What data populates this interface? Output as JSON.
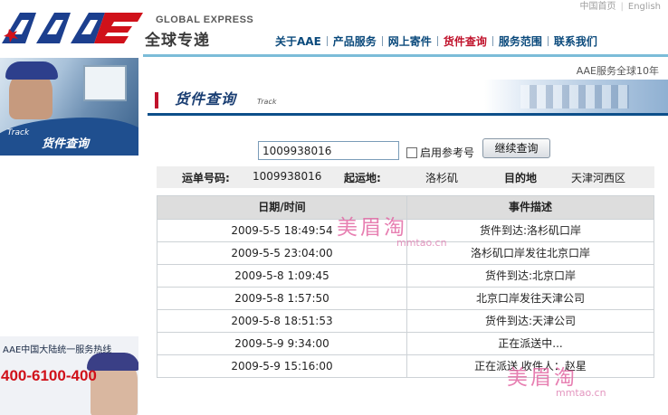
{
  "header": {
    "brand_en": "GLOBAL EXPRESS",
    "brand_cn": "全球专递",
    "logo_text": "AAE",
    "top_links": [
      "中国首页",
      "English"
    ],
    "nav": [
      {
        "label": "关于AAE",
        "active": false
      },
      {
        "label": "产品服务",
        "active": false
      },
      {
        "label": "网上寄件",
        "active": false
      },
      {
        "label": "货件查询",
        "active": true
      },
      {
        "label": "服务范围",
        "active": false
      },
      {
        "label": "联系我们",
        "active": false
      }
    ],
    "slogan": "AAE服务全球10年"
  },
  "left": {
    "banner_en": "Track",
    "banner_cn": "货件查询",
    "hotline_title": "AAE中国大陆统一服务热线",
    "hotline_number": "400-6100-400"
  },
  "page": {
    "title": "货件查询",
    "subtitle": "Track"
  },
  "search": {
    "value": "1009938016",
    "ref_label": "启用参考号",
    "button_label": "继续查询"
  },
  "info": {
    "waybill_label": "运单号码:",
    "waybill_value": "1009938016",
    "origin_label": "起运地:",
    "origin_value": "洛杉矶",
    "dest_label": "目的地",
    "dest_value": "天津河西区"
  },
  "events": {
    "headers": [
      "日期/时间",
      "事件描述"
    ],
    "rows": [
      {
        "time": "2009-5-5 18:49:54",
        "desc": "货件到达:洛杉矶口岸"
      },
      {
        "time": "2009-5-5 23:04:00",
        "desc": "洛杉矶口岸发往北京口岸"
      },
      {
        "time": "2009-5-8 1:09:45",
        "desc": "货件到达:北京口岸"
      },
      {
        "time": "2009-5-8 1:57:50",
        "desc": "北京口岸发往天津公司"
      },
      {
        "time": "2009-5-8 18:51:53",
        "desc": "货件到达:天津公司"
      },
      {
        "time": "2009-5-9 9:34:00",
        "desc": "正在派送中..."
      },
      {
        "time": "2009-5-9 15:16:00",
        "desc": "正在派送 收件人：赵星"
      }
    ]
  },
  "watermark": {
    "cn": "美眉淘",
    "en": "mmtao.cn"
  },
  "colors": {
    "nav_text": "#0b4a7c",
    "nav_active": "#c0122b",
    "logo_blue": "#1c3f8e",
    "logo_red": "#d0111a",
    "title_underline": "#0d4f8a",
    "hotline": "#d0111a"
  }
}
